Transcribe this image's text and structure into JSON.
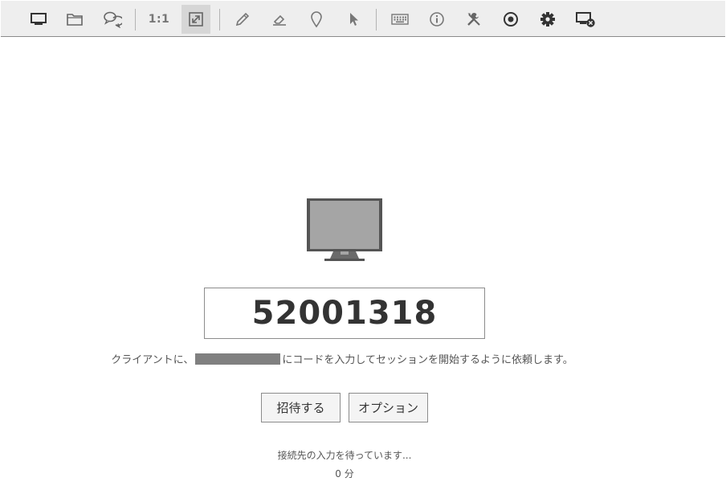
{
  "toolbar": {
    "scale_label": "1:1",
    "buttons": [
      {
        "icon": "monitor-icon"
      },
      {
        "icon": "folder-icon"
      },
      {
        "icon": "chat-icon"
      },
      {
        "icon": "scale-1to1-icon"
      },
      {
        "icon": "fit-screen-icon"
      },
      {
        "icon": "pencil-icon"
      },
      {
        "icon": "eraser-icon"
      },
      {
        "icon": "map-pin-icon"
      },
      {
        "icon": "pointer-icon"
      },
      {
        "icon": "keyboard-icon"
      },
      {
        "icon": "info-icon"
      },
      {
        "icon": "tools-icon"
      },
      {
        "icon": "record-icon"
      },
      {
        "icon": "gear-icon"
      },
      {
        "icon": "end-session-icon"
      }
    ]
  },
  "session": {
    "code": "52001318",
    "instruction_before": "クライアントに、",
    "instruction_after": "にコードを入力してセッションを開始するように依頼します。",
    "invite_label": "招待する",
    "options_label": "オプション",
    "waiting_text": "接続先の入力を待っています...",
    "elapsed_text": "0 分"
  },
  "colors": {
    "toolbar_bg": "#eeeeee",
    "icon": "#555555",
    "monitor_screen": "#a5a5a5",
    "redaction": "#808080"
  }
}
